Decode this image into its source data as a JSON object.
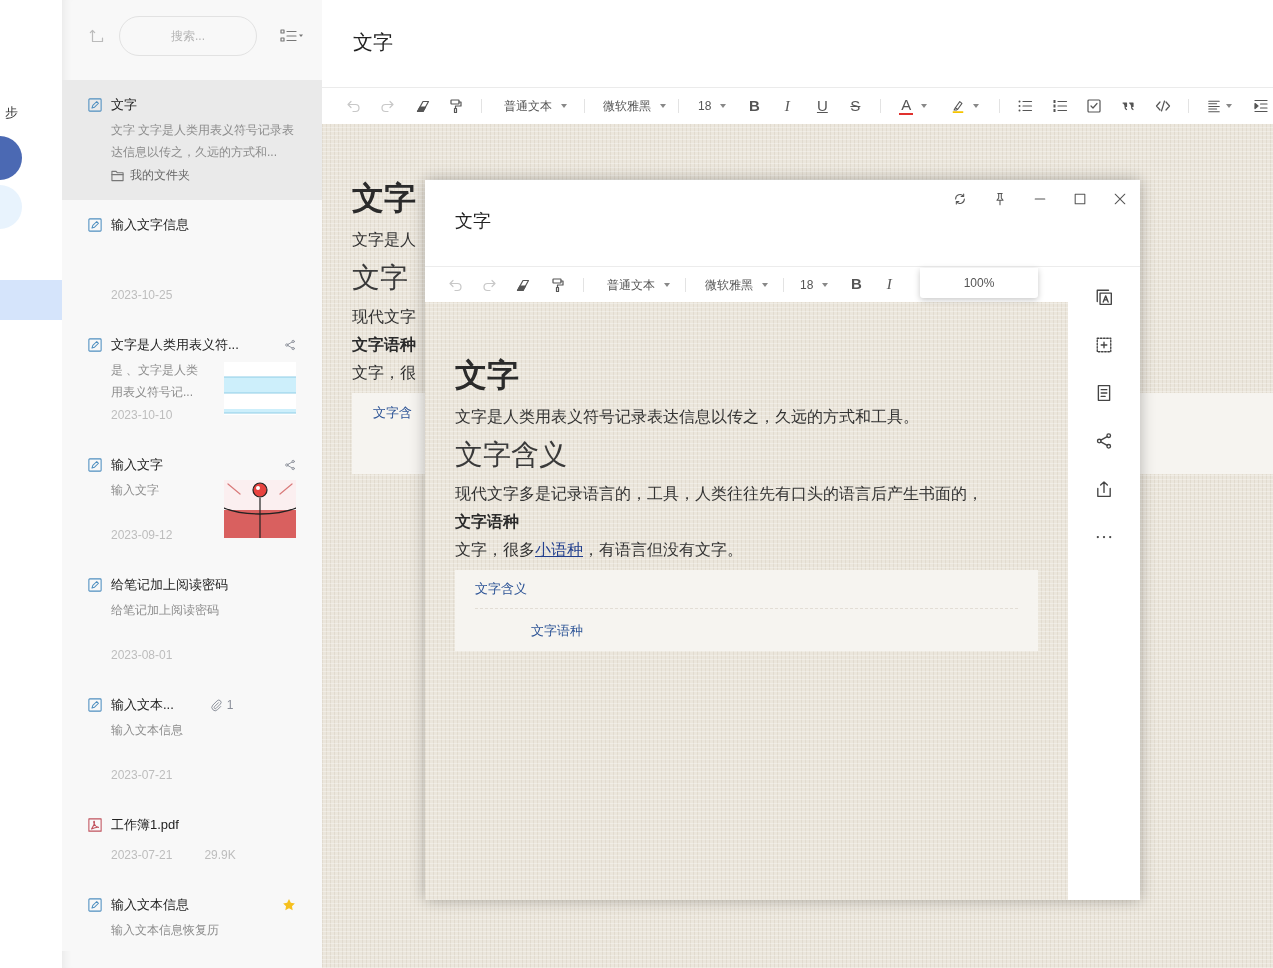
{
  "rail": {
    "label": "步"
  },
  "note_list": {
    "search": {
      "placeholder": "搜索..."
    },
    "notes": [
      {
        "kind": "note",
        "title": "文字",
        "selected": true,
        "shared": false,
        "starred": false,
        "snippet": "文字 文字是人类用表义符号记录表达信息以传之，久远的方式和...",
        "folder": "我的文件夹"
      },
      {
        "kind": "note",
        "title": "输入文字信息",
        "selected": false,
        "shared": false,
        "starred": false,
        "date": "2023-10-25"
      },
      {
        "kind": "note",
        "title": "文字是人类用表义符...",
        "selected": false,
        "shared": true,
        "starred": false,
        "snippet": "是 、文字是人类用表义符号记...",
        "thumbnail": {
          "kind": "stripes"
        },
        "date": "2023-10-10"
      },
      {
        "kind": "note",
        "title": "输入文字",
        "selected": false,
        "shared": true,
        "starred": false,
        "snippet": "输入文字",
        "thumbnail": {
          "kind": "picture"
        },
        "date": "2023-09-12"
      },
      {
        "kind": "note",
        "title": "给笔记加上阅读密码",
        "selected": false,
        "shared": false,
        "starred": false,
        "snippet": "给笔记加上阅读密码",
        "date": "2023-08-01"
      },
      {
        "kind": "note",
        "title": "输入文本...",
        "selected": false,
        "shared": false,
        "starred": false,
        "attachments": "1",
        "snippet": "输入文本信息",
        "date": "2023-07-21"
      },
      {
        "kind": "pdf",
        "title": "工作簿1.pdf",
        "selected": false,
        "shared": false,
        "starred": false,
        "date": "2023-07-21",
        "size": "29.9K"
      },
      {
        "kind": "note",
        "title": "输入文本信息",
        "selected": false,
        "shared": false,
        "starred": true,
        "snippet": "输入文本信息恢复历"
      }
    ]
  },
  "editor": {
    "title": "文字",
    "toolbar": {
      "history": [
        {
          "kind": "undo",
          "disabled": true
        },
        {
          "kind": "redo",
          "disabled": true
        }
      ],
      "paragraph_style": "普通文本",
      "font": "微软雅黑",
      "font_size": "18",
      "format": [
        {
          "kind": "bold",
          "label": "B"
        },
        {
          "kind": "italic",
          "label": "I"
        },
        {
          "kind": "underline",
          "label": "U"
        },
        {
          "kind": "strikethrough",
          "label": "S"
        }
      ],
      "font_color": "A"
    },
    "document": {
      "blocks": [
        {
          "kind": "h1",
          "text": "文字"
        },
        {
          "kind": "p",
          "text": "文字是人"
        },
        {
          "kind": "h2",
          "text": "文字"
        },
        {
          "kind": "p",
          "text": "现代文字"
        },
        {
          "kind": "h3",
          "text": "文字语种"
        },
        {
          "kind": "p",
          "text": "文字，很"
        }
      ],
      "toc": [
        {
          "text": "文字含"
        }
      ]
    }
  },
  "popup": {
    "title": "文字",
    "toolbar": {
      "history": [
        {
          "kind": "undo",
          "disabled": true
        },
        {
          "kind": "redo",
          "disabled": true
        }
      ],
      "paragraph_style": "普通文本",
      "font": "微软雅黑",
      "font_size": "18",
      "format": [
        {
          "kind": "bold",
          "label": "B"
        },
        {
          "kind": "italic",
          "label": "I"
        }
      ]
    },
    "zoom_menu": {
      "label": "100%"
    },
    "document": {
      "blocks": [
        {
          "kind": "h1",
          "text": "文字"
        },
        {
          "kind": "p",
          "text": "文字是人类用表义符号记录表达信息以传之，久远的方式和工具。"
        },
        {
          "kind": "h2",
          "text": "文字含义"
        },
        {
          "kind": "p",
          "text": "现代文字多是记录语言的，工具，人类往往先有口头的语言后产生书面的，"
        },
        {
          "kind": "h3",
          "text": "文字语种"
        },
        {
          "kind": "p",
          "segments": [
            {
              "text": "文字，很多",
              "link": false
            },
            {
              "text": "小语种",
              "link": true
            },
            {
              "text": "，有语言但没有文字。",
              "link": false
            }
          ]
        }
      ],
      "toc": [
        {
          "text": "文字含义",
          "children": [
            {
              "text": "文字语种"
            }
          ]
        }
      ]
    }
  }
}
